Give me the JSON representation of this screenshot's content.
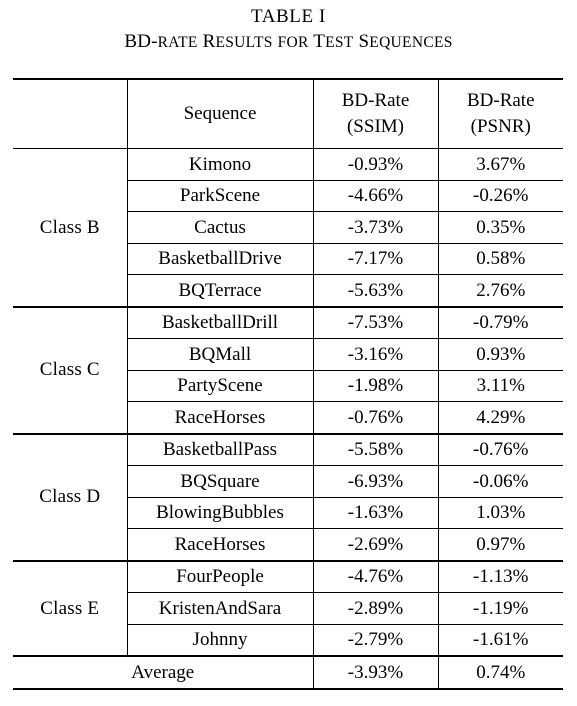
{
  "caption": {
    "table_number": "TABLE I",
    "title_parts": [
      {
        "text": "BD-",
        "style": "caps"
      },
      {
        "text": "RATE",
        "style": "smallcaps"
      },
      {
        "text": " R",
        "style": "caps"
      },
      {
        "text": "ESULTS",
        "style": "smallcaps"
      },
      {
        "text": " ",
        "style": "caps"
      },
      {
        "text": "FOR",
        "style": "smallcaps"
      },
      {
        "text": " T",
        "style": "caps"
      },
      {
        "text": "EST",
        "style": "smallcaps"
      },
      {
        "text": " S",
        "style": "caps"
      },
      {
        "text": "EQUENCES",
        "style": "smallcaps"
      }
    ],
    "title_plain": "BD-rate Results for Test Sequences"
  },
  "table": {
    "headers": {
      "class_col": "",
      "sequence": "Sequence",
      "ssim_line1": "BD-Rate",
      "ssim_line2": "(SSIM)",
      "psnr_line1": "BD-Rate",
      "psnr_line2": "(PSNR)"
    },
    "groups": [
      {
        "label": "Class  B",
        "rows": [
          {
            "sequence": "Kimono",
            "ssim": "-0.93%",
            "psnr": "3.67%"
          },
          {
            "sequence": "ParkScene",
            "ssim": "-4.66%",
            "psnr": "-0.26%"
          },
          {
            "sequence": "Cactus",
            "ssim": "-3.73%",
            "psnr": "0.35%"
          },
          {
            "sequence": "BasketballDrive",
            "ssim": "-7.17%",
            "psnr": "0.58%"
          },
          {
            "sequence": "BQTerrace",
            "ssim": "-5.63%",
            "psnr": "2.76%"
          }
        ]
      },
      {
        "label": "Class  C",
        "rows": [
          {
            "sequence": "BasketballDrill",
            "ssim": "-7.53%",
            "psnr": "-0.79%"
          },
          {
            "sequence": "BQMall",
            "ssim": "-3.16%",
            "psnr": "0.93%"
          },
          {
            "sequence": "PartyScene",
            "ssim": "-1.98%",
            "psnr": "3.11%"
          },
          {
            "sequence": "RaceHorses",
            "ssim": "-0.76%",
            "psnr": "4.29%"
          }
        ]
      },
      {
        "label": "Class  D",
        "rows": [
          {
            "sequence": "BasketballPass",
            "ssim": "-5.58%",
            "psnr": "-0.76%"
          },
          {
            "sequence": "BQSquare",
            "ssim": "-6.93%",
            "psnr": "-0.06%"
          },
          {
            "sequence": "BlowingBubbles",
            "ssim": "-1.63%",
            "psnr": "1.03%"
          },
          {
            "sequence": "RaceHorses",
            "ssim": "-2.69%",
            "psnr": "0.97%"
          }
        ]
      },
      {
        "label": "Class  E",
        "rows": [
          {
            "sequence": "FourPeople",
            "ssim": "-4.76%",
            "psnr": "-1.13%"
          },
          {
            "sequence": "KristenAndSara",
            "ssim": "-2.89%",
            "psnr": "-1.19%"
          },
          {
            "sequence": "Johnny",
            "ssim": "-2.79%",
            "psnr": "-1.61%"
          }
        ]
      }
    ],
    "average": {
      "label": "Average",
      "ssim": "-3.93%",
      "psnr": "0.74%"
    }
  }
}
